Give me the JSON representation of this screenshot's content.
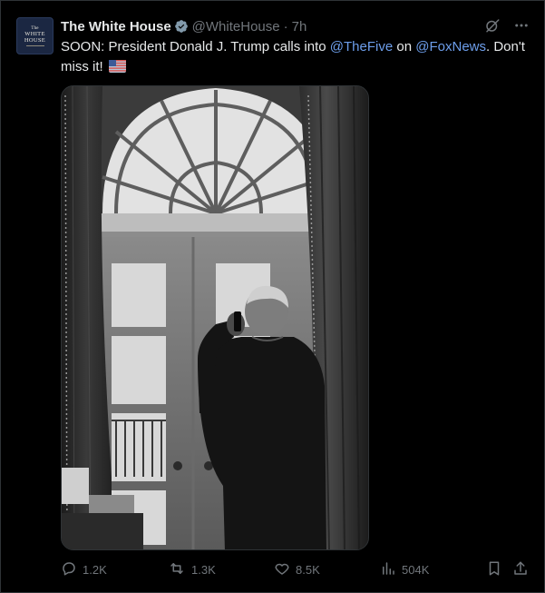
{
  "avatar": {
    "seal_top": "The",
    "seal_line1": "WHITE",
    "seal_line2": "HOUSE"
  },
  "author": {
    "display_name": "The White House",
    "handle": "@WhiteHouse",
    "separator": "·",
    "time": "7h",
    "verified_icon": "verified-badge-icon"
  },
  "tweet": {
    "text_before": "SOON: President Donald J. Trump calls into ",
    "mention1": "@TheFive",
    "text_middle": " on ",
    "mention2": "@FoxNews",
    "text_after": ". Don't miss it!",
    "emoji": "us-flag-emoji"
  },
  "media": {
    "type": "photo",
    "style": "black-and-white",
    "subject": "man on phone at window"
  },
  "actions": {
    "reply_count": "1.2K",
    "retweet_count": "1.3K",
    "like_count": "8.5K",
    "views_count": "504K"
  },
  "colors": {
    "background": "#000000",
    "text": "#e7e9ea",
    "muted": "#71767b",
    "link": "#6d9eeb",
    "verified": "#829aab"
  }
}
